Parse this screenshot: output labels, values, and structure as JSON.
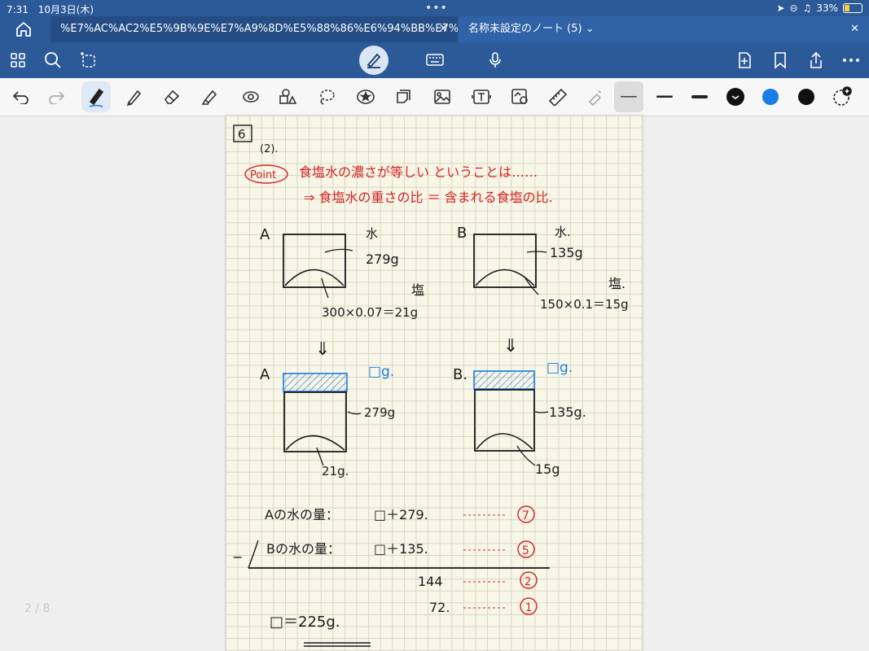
{
  "status": {
    "time": "7:31",
    "date": "10月3日(木)",
    "battery": "33%"
  },
  "tabs": [
    {
      "title": "%E7%AC%AC2%E5%9B%9E%E7%A9%8D%E5%88%86%E6%94%BB%E7%95%..."
    },
    {
      "title": "名称未設定のノート (5)"
    }
  ],
  "colors": {
    "chrome": "#2c5a98",
    "accent_blue": "#1a7ce6",
    "red_ink": "#d42323",
    "black_ink": "#1a1a1a"
  },
  "page_counter": "2 / 8",
  "note": {
    "problem_box": "6",
    "part": "(2).",
    "point_label": "Point",
    "point_line1": "食塩水の濃さが等しい ということは……",
    "point_line2": "⇒ 食塩水の重さの比 ＝ 含まれる食塩の比.",
    "a_label": "A",
    "b_label": "B",
    "a_water_label": "水",
    "b_water_label": "水.",
    "a_water": "279g",
    "b_water": "135g",
    "a_salt_label": "塩",
    "b_salt_label": "塩.",
    "a_salt_calc": "300×0.07＝21g",
    "b_salt_calc": "150×0.1＝15g",
    "arrow": "⇓",
    "a2_label": "A",
    "b2_label": "B.",
    "a2_box": "□g.",
    "b2_box": "□g.",
    "a2_water": "279g",
    "b2_water": "135g.",
    "a2_salt": "21g.",
    "b2_salt": "15g",
    "eq1_left": "Aの水の量：",
    "eq1_right": "□＋279.",
    "eq1_ratio": "7",
    "eq2_minus": "−",
    "eq2_left": "Bの水の量：",
    "eq2_right": "□＋135.",
    "eq2_ratio": "5",
    "diff": "144",
    "diff_ratio": "2",
    "unit": "72.",
    "unit_ratio": "1",
    "answer": "□＝225g."
  }
}
